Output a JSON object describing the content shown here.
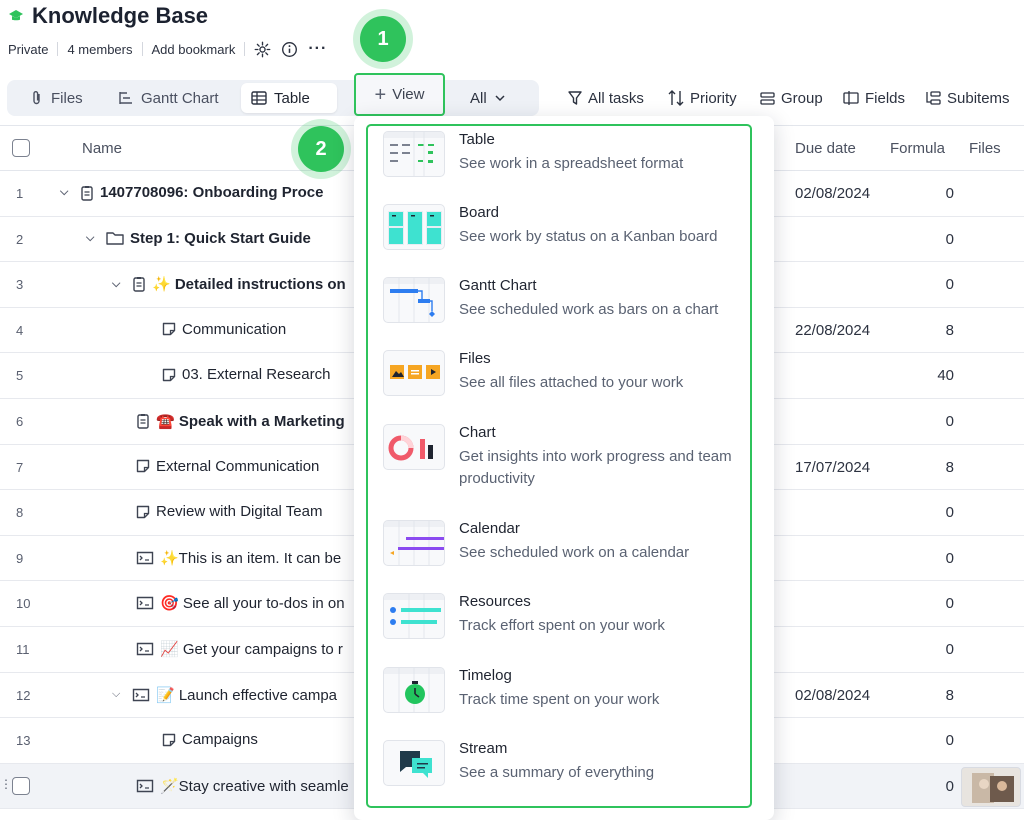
{
  "header": {
    "title": "Knowledge Base",
    "meta": [
      "Private",
      "4 members",
      "Add bookmark"
    ],
    "icons": [
      "graduation-cap-icon",
      "gear-icon",
      "info-icon",
      "more-icon"
    ]
  },
  "toolbar": {
    "tabs": [
      {
        "label": "Files",
        "icon": "paperclip-icon"
      },
      {
        "label": "Gantt Chart",
        "icon": "gantt-icon"
      },
      {
        "label": "Table",
        "icon": "table-icon"
      }
    ],
    "view_label": "View",
    "all_label": "All",
    "tools": [
      {
        "label": "All tasks",
        "icon": "filter-icon"
      },
      {
        "label": "Priority",
        "icon": "sort-icon"
      },
      {
        "label": "Group",
        "icon": "group-icon"
      },
      {
        "label": "Fields",
        "icon": "fields-icon"
      },
      {
        "label": "Subitems",
        "icon": "subitems-icon"
      }
    ],
    "accent": "#2fc35c"
  },
  "badges": [
    "1",
    "2"
  ],
  "table": {
    "columns": [
      "Name",
      "Due date",
      "Formula",
      "Files"
    ],
    "rows": [
      {
        "num": "1",
        "name": "1407708096: Onboarding Proce",
        "due": "02/08/2024",
        "formula": "0"
      },
      {
        "num": "2",
        "name": "Step 1: Quick Start Guide",
        "due": "",
        "formula": "0"
      },
      {
        "num": "3",
        "name": "✨ Detailed instructions on",
        "due": "",
        "formula": "0"
      },
      {
        "num": "4",
        "name": "Communication",
        "due": "22/08/2024",
        "formula": "8"
      },
      {
        "num": "5",
        "name": "03. External Research",
        "due": "",
        "formula": "40"
      },
      {
        "num": "6",
        "name": "☎️ Speak with a Marketing",
        "due": "",
        "formula": "0"
      },
      {
        "num": "7",
        "name": "External Communication",
        "due": "17/07/2024",
        "formula": "8"
      },
      {
        "num": "8",
        "name": "Review with Digital Team",
        "due": "",
        "formula": "0"
      },
      {
        "num": "9",
        "name": "✨This is an item. It can be",
        "due": "",
        "formula": "0"
      },
      {
        "num": "10",
        "name": "🎯 See all your to-dos in on",
        "due": "",
        "formula": "0"
      },
      {
        "num": "11",
        "name": "📈 Get your campaigns to r",
        "due": "",
        "formula": "0"
      },
      {
        "num": "12",
        "name": "📝 Launch effective campa",
        "due": "02/08/2024",
        "formula": "8"
      },
      {
        "num": "13",
        "name": "Campaigns",
        "due": "",
        "formula": "0"
      },
      {
        "num": "",
        "name": "🪄Stay creative with seamle",
        "due": "",
        "formula": "0"
      }
    ]
  },
  "view_menu": {
    "items": [
      {
        "title": "Table",
        "desc": "See work in a spreadsheet format"
      },
      {
        "title": "Board",
        "desc": "See work by status on a Kanban board"
      },
      {
        "title": "Gantt Chart",
        "desc": "See scheduled work as bars on a chart"
      },
      {
        "title": "Files",
        "desc": "See all files attached to your work"
      },
      {
        "title": "Chart",
        "desc": "Get insights into work progress and team productivity"
      },
      {
        "title": "Calendar",
        "desc": "See scheduled work on a calendar"
      },
      {
        "title": "Resources",
        "desc": "Track effort spent on your work"
      },
      {
        "title": "Timelog",
        "desc": "Track time spent on your work"
      },
      {
        "title": "Stream",
        "desc": "See a summary of everything"
      }
    ]
  }
}
